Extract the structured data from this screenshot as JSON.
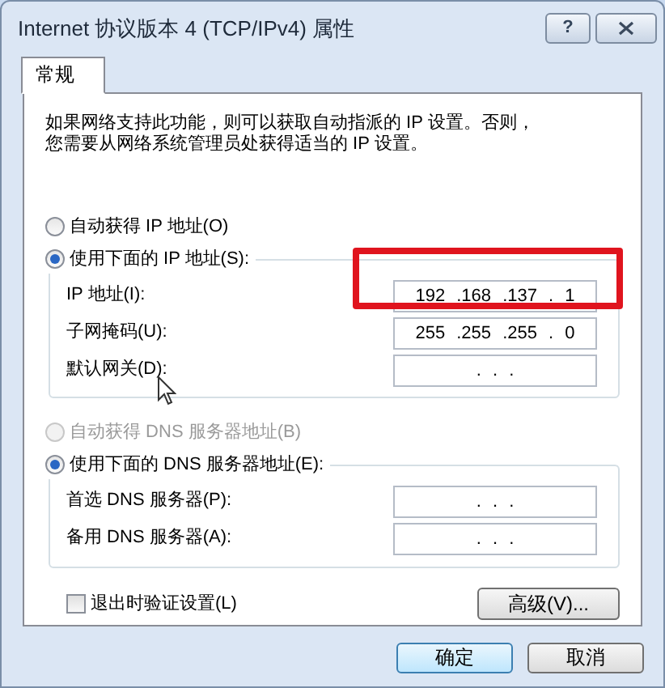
{
  "window": {
    "title": "Internet 协议版本 4 (TCP/IPv4) 属性",
    "help_button": "?"
  },
  "tabs": [
    {
      "label": "常规",
      "selected": true
    }
  ],
  "description": [
    "如果网络支持此功能，则可以获取自动指派的 IP 设置。否则，",
    "您需要从网络系统管理员处获得适当的 IP 设置。"
  ],
  "ip_options": [
    {
      "label": "自动获得 IP 地址(O)",
      "selected": false,
      "disabled": false
    },
    {
      "label": "使用下面的 IP 地址(S):",
      "selected": true,
      "disabled": false
    }
  ],
  "ip_fields": [
    {
      "label": "IP 地址(I):",
      "value": "192 .168 .137 . 1",
      "highlighted": true
    },
    {
      "label": "子网掩码(U):",
      "value": "255 .255 .255 . 0",
      "highlighted": false
    },
    {
      "label": "默认网关(D):",
      "value": ". . .",
      "highlighted": false
    }
  ],
  "dns_options": [
    {
      "label": "自动获得 DNS 服务器地址(B)",
      "selected": false,
      "disabled": true
    },
    {
      "label": "使用下面的 DNS 服务器地址(E):",
      "selected": true,
      "disabled": false
    }
  ],
  "dns_fields": [
    {
      "label": "首选 DNS 服务器(P):",
      "value": ". . .",
      "highlighted": false
    },
    {
      "label": "备用 DNS 服务器(A):",
      "value": ". . .",
      "highlighted": false
    }
  ],
  "validate_checkbox": {
    "label": "退出时验证设置(L)",
    "checked": false
  },
  "advanced_button": "高级(V)...",
  "buttons": [
    {
      "label": "确定",
      "default": true
    },
    {
      "label": "取消",
      "default": false
    }
  ]
}
